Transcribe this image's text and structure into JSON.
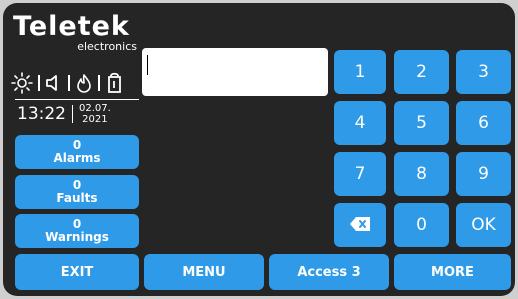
{
  "brand": {
    "name": "Teletek",
    "sub": "electronics"
  },
  "status_icons": [
    "brightness-icon",
    "volume-icon",
    "fire-icon",
    "door-icon"
  ],
  "clock": {
    "time": "13:22",
    "date_day": "02.07.",
    "date_year": "2021"
  },
  "counters": [
    {
      "count": "0",
      "label": "Alarms"
    },
    {
      "count": "0",
      "label": "Faults"
    },
    {
      "count": "0",
      "label": "Warnings"
    }
  ],
  "input": {
    "value": ""
  },
  "keypad": [
    "1",
    "2",
    "3",
    "4",
    "5",
    "6",
    "7",
    "8",
    "9",
    "0",
    "OK"
  ],
  "bottom": {
    "exit": "EXIT",
    "menu": "MENU",
    "access": "Access 3",
    "more": "MORE"
  },
  "colors": {
    "button": "#2f9be8",
    "background": "#252525"
  }
}
